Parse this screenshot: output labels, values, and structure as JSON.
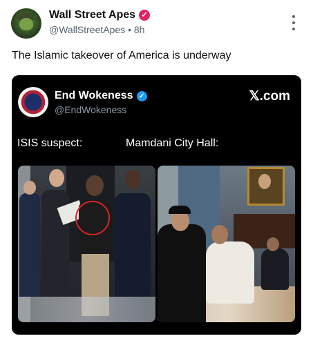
{
  "post": {
    "display_name": "Wall Street Apes",
    "handle": "@WallStreetApes",
    "separator": "•",
    "time": "8h",
    "text": "The Islamic takeover of America is underway"
  },
  "quoted": {
    "display_name": "End Wokeness",
    "handle": "@EndWokeness",
    "source": "𝕏.com",
    "caption_left": "ISIS suspect:",
    "caption_right": "Mamdani City Hall:"
  },
  "icons": {
    "verified_post": "verified-badge-pink",
    "verified_quoted": "verified-badge-blue",
    "more": "more-vertical-icon"
  },
  "colors": {
    "post_badge": "#e0245e",
    "quoted_badge": "#1d9bf0",
    "card_bg": "#000000"
  }
}
